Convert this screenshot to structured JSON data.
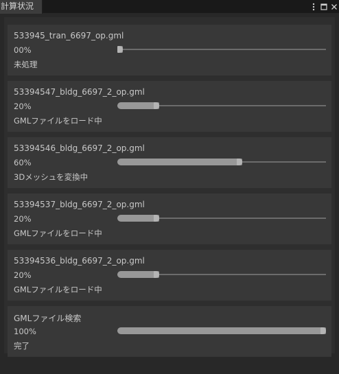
{
  "window": {
    "tab_title": "計算状況",
    "menu_icon": "kebab-menu-icon",
    "maximize_icon": "maximize-icon",
    "close_icon": "close-icon"
  },
  "tasks": [
    {
      "file": "533945_tran_6697_op.gml",
      "percent_text": "00%",
      "progress": 0.0,
      "status": "未処理"
    },
    {
      "file": "53394547_bldg_6697_2_op.gml",
      "percent_text": "20%",
      "progress": 0.2,
      "status": "GMLファイルをロード中"
    },
    {
      "file": "53394546_bldg_6697_2_op.gml",
      "percent_text": "60%",
      "progress": 0.6,
      "status": "3Dメッシュを変換中"
    },
    {
      "file": "53394537_bldg_6697_2_op.gml",
      "percent_text": "20%",
      "progress": 0.2,
      "status": "GMLファイルをロード中"
    },
    {
      "file": "53394536_bldg_6697_2_op.gml",
      "percent_text": "20%",
      "progress": 0.2,
      "status": "GMLファイルをロード中"
    },
    {
      "file": "GMLファイル検索",
      "percent_text": "100%",
      "progress": 1.0,
      "status": "完了"
    }
  ],
  "colors": {
    "background": "#282828",
    "card": "#383838",
    "track": "#6c6c6c",
    "fill": "#989898",
    "text": "#c8c8c8"
  }
}
